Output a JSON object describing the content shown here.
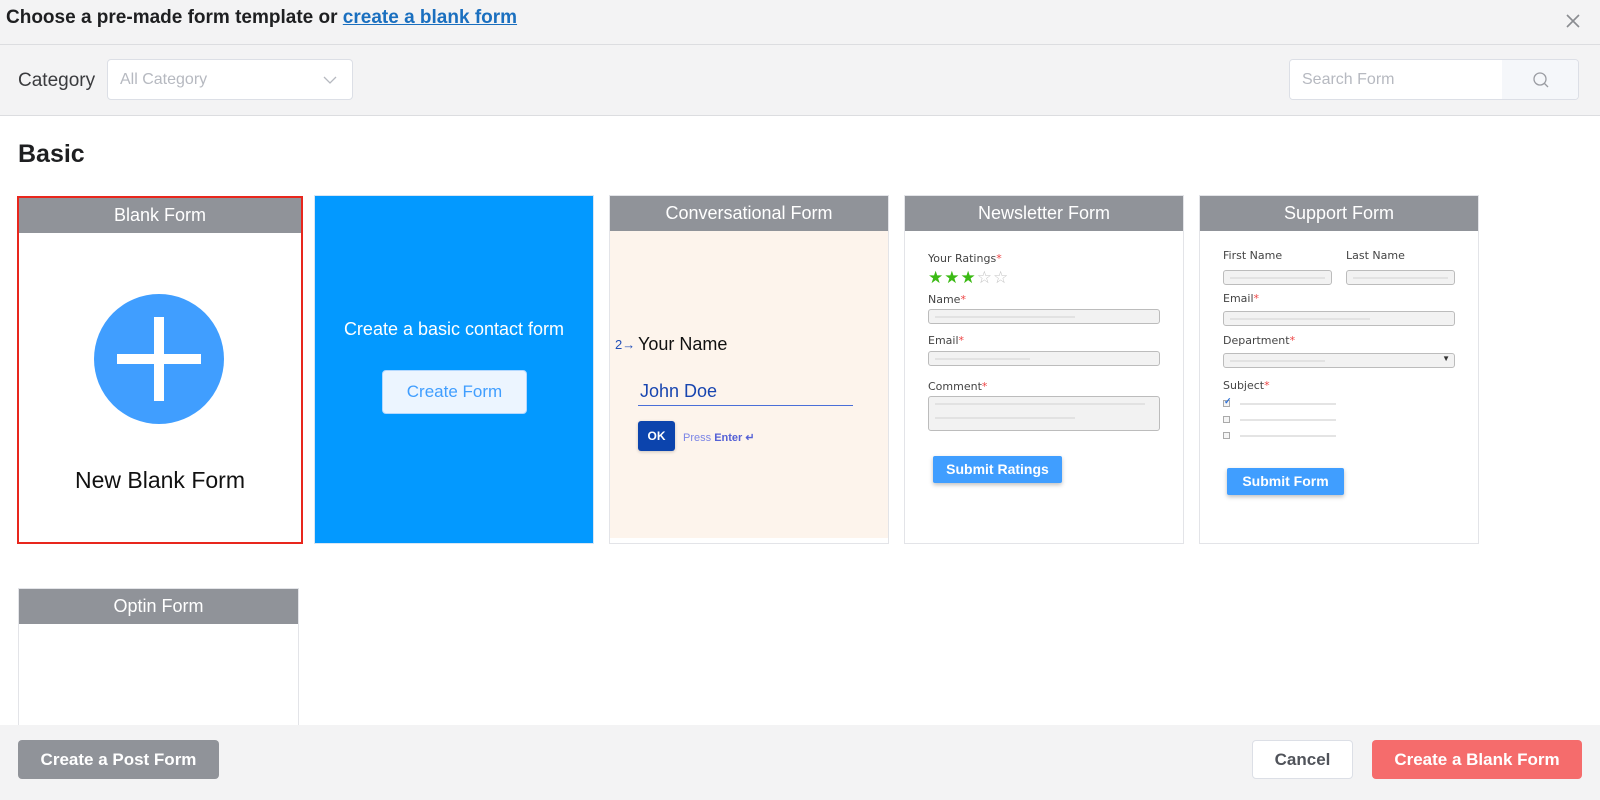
{
  "header": {
    "title_prefix": "Choose a pre-made form template or ",
    "title_link": "create a blank form",
    "close_icon": "close-icon"
  },
  "filters": {
    "category_label": "Category",
    "category_value": "All Category",
    "search_placeholder": "Search Form"
  },
  "section": {
    "title": "Basic"
  },
  "cards": {
    "blank": {
      "title": "Blank Form",
      "label": "New Blank Form",
      "selected": true
    },
    "basic": {
      "message": "Create a basic contact form",
      "button": "Create Form"
    },
    "conversational": {
      "title": "Conversational Form",
      "question_number": "2→",
      "question": "Your Name",
      "answer": "John Doe",
      "ok": "OK",
      "press": "Press",
      "enter": "Enter ↵"
    },
    "newsletter": {
      "title": "Newsletter Form",
      "ratings_label": "Your Ratings",
      "rating": 3,
      "rating_max": 5,
      "name_label": "Name",
      "email_label": "Email",
      "comment_label": "Comment",
      "required_mark": "*",
      "submit": "Submit Ratings"
    },
    "support": {
      "title": "Support Form",
      "first_name_label": "First Name",
      "last_name_label": "Last Name",
      "email_label": "Email",
      "department_label": "Department",
      "subject_label": "Subject",
      "required_mark": "*",
      "subject_checked": [
        true,
        false,
        false
      ],
      "submit": "Submit Form"
    },
    "optin": {
      "title": "Optin Form"
    }
  },
  "footer": {
    "post_form": "Create a Post Form",
    "cancel": "Cancel",
    "create_blank": "Create a Blank Form"
  },
  "colors": {
    "primary": "#409eff",
    "danger": "#f56c6c",
    "card_header": "#909399",
    "basic_card": "#0399ff",
    "selected_border": "#e8261d",
    "link": "#1a6fbf"
  }
}
